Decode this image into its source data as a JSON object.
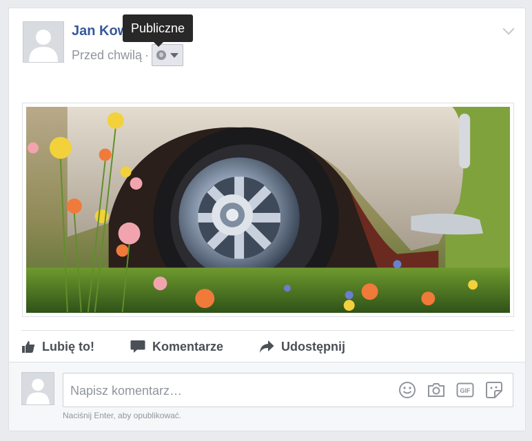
{
  "post": {
    "author": "Jan Kowalski",
    "timestamp": "Przed chwilą",
    "separator": "·",
    "privacy": {
      "tooltip": "Publiczne",
      "icon": "globe-icon"
    },
    "menu_icon": "chevron-down-icon",
    "photo": {
      "subject": "vintage car wheel in flower meadow"
    }
  },
  "actions": [
    {
      "label": "Lubię to!",
      "icon": "thumbs-up-icon"
    },
    {
      "label": "Komentarze",
      "icon": "comment-icon"
    },
    {
      "label": "Udostępnij",
      "icon": "share-icon"
    }
  ],
  "comment": {
    "placeholder": "Napisz komentarz…",
    "value": "",
    "hint": "Naciśnij Enter, aby opublikować.",
    "icons": [
      "emoji-icon",
      "camera-icon",
      "gif-icon",
      "sticker-icon"
    ]
  },
  "colors": {
    "author": "#365899",
    "secondary_text": "#90949c",
    "action_text": "#4b4f56",
    "tooltip_bg": "#282828"
  }
}
